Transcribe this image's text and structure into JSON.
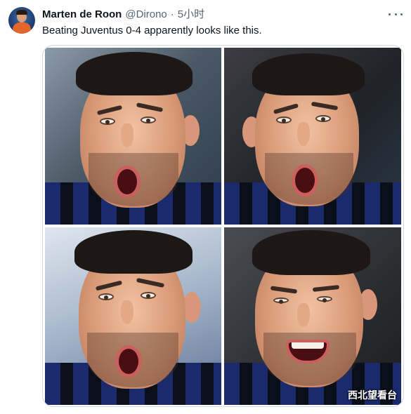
{
  "tweet": {
    "author_name": "Marten de Roon",
    "handle": "@Dirono",
    "separator": "·",
    "time": "5小时",
    "text": "Beating Juventus 0-4 apparently looks like this."
  },
  "media": {
    "photo_count": 4,
    "watermark": "西北望看台"
  },
  "icons": {
    "more": "more-horizontal-icon"
  },
  "colors": {
    "text_primary": "#0f1419",
    "text_secondary": "#536471",
    "border": "#cfd9de"
  }
}
